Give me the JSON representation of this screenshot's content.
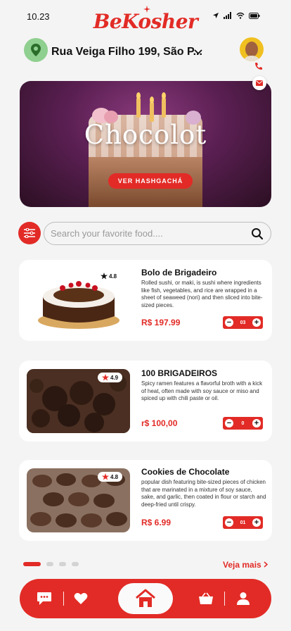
{
  "status_bar": {
    "time": "10.23"
  },
  "brand": {
    "name": "BeKosher"
  },
  "location": {
    "address": "Rua Veiga Filho 199, São P..."
  },
  "banner": {
    "title": "Chocolot",
    "button_label": "VER HASHGACHÁ"
  },
  "search": {
    "placeholder": "Search your favorite food...."
  },
  "products": [
    {
      "title": "Bolo de Brigadeiro",
      "rating": "4.8",
      "description": "Rolled sushi, or maki, is sushi where ingredients like fish, vegetables, and rice are wrapped in a sheet of seaweed (nori) and then sliced into bite-sized pieces.",
      "price": "R$ 197.99",
      "quantity": "03"
    },
    {
      "title": "100 BRIGADEIROS",
      "rating": "4.9",
      "description": "Spicy ramen features a flavorful broth with a kick of heat, often made with soy sauce or miso and spiced up with chili paste or oil.",
      "price": "r$ 100,00",
      "quantity": "0"
    },
    {
      "title": "Cookies de Chocolate",
      "rating": "4.8",
      "description": "popular dish featuring bite-sized pieces of chicken that are marinated in a mixture of soy sauce, sake, and garlic, then coated in flour or starch and deep-fried until crispy.",
      "price": "R$ 6.99",
      "quantity": "01"
    }
  ],
  "pagination": {
    "see_more": "Veja mais"
  },
  "colors": {
    "accent": "#e22b26",
    "background": "#f4f4f4",
    "card": "#ffffff",
    "location_pin_bg": "#8fcf8f"
  },
  "icons": {
    "status": [
      "location-arrow-icon",
      "signal-icon",
      "wifi-icon",
      "battery-icon"
    ],
    "nav": [
      "chat-icon",
      "heart-icon",
      "home-icon",
      "basket-icon",
      "user-icon"
    ]
  }
}
